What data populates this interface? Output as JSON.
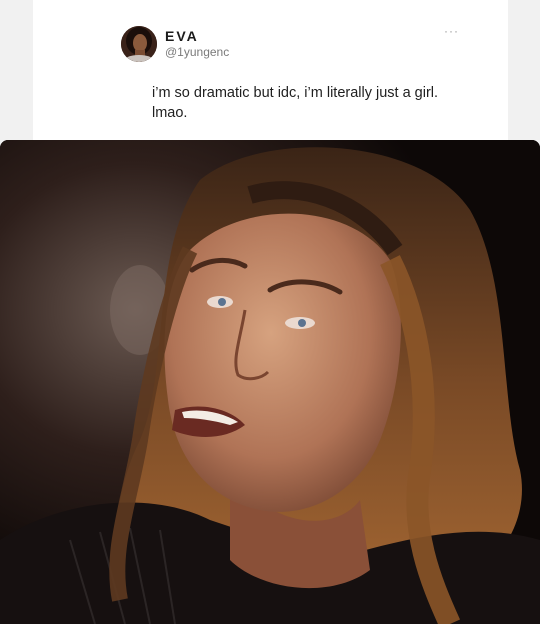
{
  "tweet": {
    "display_name": "EVA",
    "handle": "@1yungenc",
    "more_label": "···",
    "text_line1": "i’m so dramatic but idc, i’m literally just a girl.",
    "text_line2": "lmao."
  },
  "colors": {
    "card_bg": "#ffffff",
    "page_bg": "#f1f1f1",
    "name_color": "#1b1b1b",
    "handle_color": "#7a7a7a",
    "text_color": "#1f1f1f"
  },
  "icons": {
    "more": "more-horizontal-icon",
    "avatar": "profile-avatar"
  }
}
